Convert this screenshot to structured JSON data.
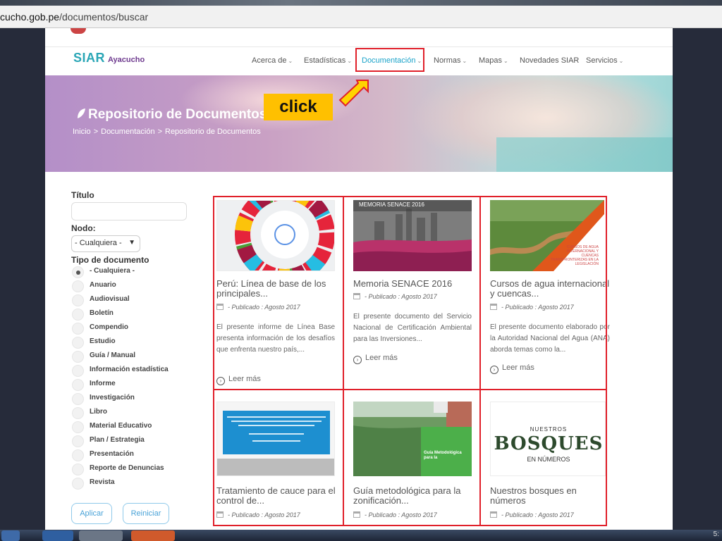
{
  "browser": {
    "url_host": "cucho.gob.pe",
    "url_path": "/documentos/buscar"
  },
  "site": {
    "brand": "SIAR",
    "brand_sub": "Ayacucho",
    "nav": [
      {
        "label": "Acerca de"
      },
      {
        "label": "Estadísticas"
      },
      {
        "label": "Documentación"
      },
      {
        "label": "Normas"
      },
      {
        "label": "Mapas"
      },
      {
        "label": "Novedades SIAR"
      },
      {
        "label": "Servicios"
      }
    ]
  },
  "hero": {
    "title": "Repositorio de Documentos",
    "breadcrumb": [
      "Inicio",
      ">",
      "Documentación",
      ">",
      "Repositorio de Documentos"
    ]
  },
  "annotation": {
    "callout": "click"
  },
  "filters": {
    "titulo_label": "Título",
    "titulo_value": "",
    "nodo_label": "Nodo:",
    "nodo_selected": "- Cualquiera -",
    "tipo_label": "Tipo de documento",
    "tipo_options": [
      "- Cualquiera -",
      "Anuario",
      "Audiovisual",
      "Boletín",
      "Compendio",
      "Estudio",
      "Guía / Manual",
      "Información estadística",
      "Informe",
      "Investigación",
      "Libro",
      "Material Educativo",
      "Plan / Estrategia",
      "Presentación",
      "Reporte de Denuncias",
      "Revista"
    ],
    "tipo_selected": "- Cualquiera -",
    "apply_label": "Aplicar",
    "reset_label": "Reiniciar"
  },
  "results": [
    {
      "title": "Perú: Línea de base de los principales...",
      "published": "- Publicado : Agosto 2017",
      "description": "El presente informe de Línea Base presenta información de los desafíos que enfrenta nuestro país,...",
      "more": "Leer más"
    },
    {
      "title": "Memoria SENACE 2016",
      "published": "- Publicado : Agosto 2017",
      "description": "El presente documento del Servicio Nacional de Certificación Ambiental para las Inversiones...",
      "more": "Leer más",
      "cover_title": "MEMORIA SENACE 2016"
    },
    {
      "title": "Cursos de agua internacional y cuencas...",
      "published": "- Publicado : Agosto 2017",
      "description": "El presente documento elaborado por la Autoridad Nacional del Agua (ANA) aborda temas como la...",
      "more": "Leer más",
      "cover_title": "CURSOS DE AGUA INTERNACIONAL Y CUENCAS TRANSFRONTERIZAS EN LA LEGISLACIÓN"
    },
    {
      "title": "Tratamiento de cauce para el control de...",
      "published": "- Publicado : Agosto 2017"
    },
    {
      "title": "Guía metodológica para la zonificación...",
      "published": "- Publicado : Agosto 2017",
      "cover_title": "Guía Metodológica para la"
    },
    {
      "title": "Nuestros bosques en números",
      "published": "- Publicado : Agosto 2017",
      "cover_title": [
        "NUESTROS",
        "BOSQUES",
        "EN NÚMEROS"
      ]
    }
  ],
  "taskbar": {
    "clock": "5:"
  },
  "colors": {
    "accent": "#1aa3c9",
    "highlight_box": "#e0202a",
    "callout_bg": "#ffc000",
    "brand": "#2aa6b6"
  }
}
